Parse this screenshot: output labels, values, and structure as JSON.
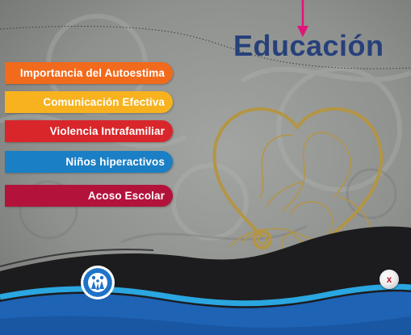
{
  "title": "Educación",
  "menu": {
    "items": [
      {
        "label": "Importancia del Autoestima",
        "color": "#f26a1b"
      },
      {
        "label": "Comunicación Efectiva",
        "color": "#f7b21e"
      },
      {
        "label": "Violencia Intrafamiliar",
        "color": "#d9262a"
      },
      {
        "label": "Niños hiperactivos",
        "color": "#1a7fc4"
      },
      {
        "label": "Acoso Escolar",
        "color": "#b3123a"
      }
    ]
  },
  "close_button": {
    "label": "x"
  },
  "colors": {
    "title": "#26407a",
    "indicator_arrow": "#e0157a",
    "wave_dark": "#1c1c1e",
    "wave_blue": "#1e63b4",
    "wave_light_blue": "#2aa6e0",
    "heart_outline": "#b39545"
  },
  "icons": {
    "arrow": "arrow-down-icon",
    "logo": "organization-logo-icon",
    "illustration": "mother-baby-stethoscope-heart-icon"
  }
}
